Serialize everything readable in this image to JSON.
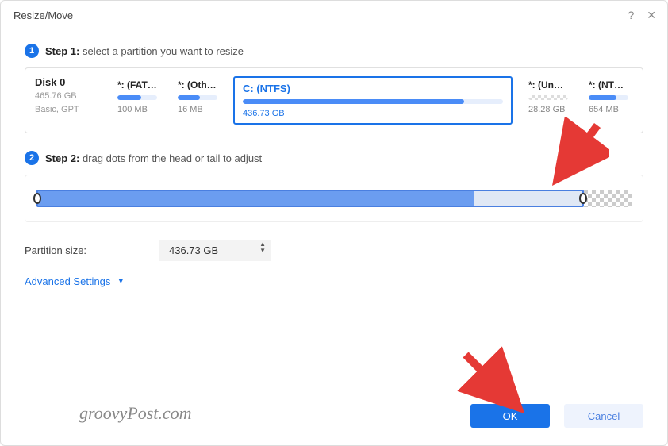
{
  "window": {
    "title": "Resize/Move"
  },
  "step1": {
    "badge": "1",
    "name": "Step 1:",
    "desc": "select a partition you want to resize"
  },
  "disk": {
    "name": "Disk 0",
    "size": "465.76 GB",
    "scheme": "Basic, GPT",
    "partitions": [
      {
        "label": "*: (FAT…",
        "size": "100 MB",
        "fill": 60
      },
      {
        "label": "*: (Oth…",
        "size": "16 MB",
        "fill": 55
      },
      {
        "label": "C: (NTFS)",
        "size": "436.73 GB",
        "fill": 85,
        "selected": true
      },
      {
        "label": "*: (Unallo…",
        "size": "28.28 GB",
        "unalloc": true
      },
      {
        "label": "*: (NT…",
        "size": "654 MB",
        "fill": 70
      }
    ]
  },
  "step2": {
    "badge": "2",
    "name": "Step 2:",
    "desc": "drag dots from the head or tail to adjust"
  },
  "sizeField": {
    "label": "Partition size:",
    "value": "436.73 GB"
  },
  "advanced": {
    "label": "Advanced Settings"
  },
  "buttons": {
    "ok": "OK",
    "cancel": "Cancel"
  },
  "watermark": "groovyPost.com"
}
